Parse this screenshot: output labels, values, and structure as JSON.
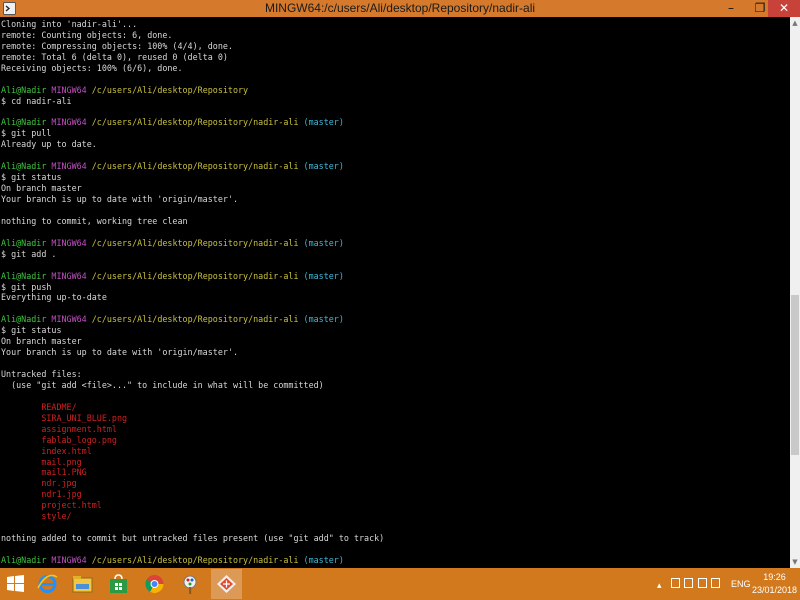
{
  "window": {
    "title": "MINGW64:/c/users/Ali/desktop/Repository/nadir-ali",
    "minimize_glyph": "–",
    "maximize_glyph": "❐",
    "close_glyph": "✕"
  },
  "terminal": {
    "lines": [
      [
        {
          "t": "Cloning into 'nadir-ali'..."
        }
      ],
      [
        {
          "t": "remote: Counting objects: 6, done."
        }
      ],
      [
        {
          "t": "remote: Compressing objects: 100% (4/4), done."
        }
      ],
      [
        {
          "t": "remote: Total 6 (delta 0), reused 0 (delta 0)"
        }
      ],
      [
        {
          "t": "Receiving objects: 100% (6/6), done."
        }
      ],
      [
        {
          "t": ""
        }
      ],
      [
        {
          "t": "Ali@Nadir ",
          "c": "user"
        },
        {
          "t": "MINGW64 ",
          "c": "env"
        },
        {
          "t": "/c/users/Ali/desktop/Repository",
          "c": "path"
        }
      ],
      [
        {
          "t": "$ cd nadir-ali"
        }
      ],
      [
        {
          "t": ""
        }
      ],
      [
        {
          "t": "Ali@Nadir ",
          "c": "user"
        },
        {
          "t": "MINGW64 ",
          "c": "env"
        },
        {
          "t": "/c/users/Ali/desktop/Repository/nadir-ali",
          "c": "path"
        },
        {
          "t": " (master)",
          "c": "branch"
        }
      ],
      [
        {
          "t": "$ git pull"
        }
      ],
      [
        {
          "t": "Already up to date."
        }
      ],
      [
        {
          "t": ""
        }
      ],
      [
        {
          "t": "Ali@Nadir ",
          "c": "user"
        },
        {
          "t": "MINGW64 ",
          "c": "env"
        },
        {
          "t": "/c/users/Ali/desktop/Repository/nadir-ali",
          "c": "path"
        },
        {
          "t": " (master)",
          "c": "branch"
        }
      ],
      [
        {
          "t": "$ git status"
        }
      ],
      [
        {
          "t": "On branch master"
        }
      ],
      [
        {
          "t": "Your branch is up to date with 'origin/master'."
        }
      ],
      [
        {
          "t": ""
        }
      ],
      [
        {
          "t": "nothing to commit, working tree clean"
        }
      ],
      [
        {
          "t": ""
        }
      ],
      [
        {
          "t": "Ali@Nadir ",
          "c": "user"
        },
        {
          "t": "MINGW64 ",
          "c": "env"
        },
        {
          "t": "/c/users/Ali/desktop/Repository/nadir-ali",
          "c": "path"
        },
        {
          "t": " (master)",
          "c": "branch"
        }
      ],
      [
        {
          "t": "$ git add ."
        }
      ],
      [
        {
          "t": ""
        }
      ],
      [
        {
          "t": "Ali@Nadir ",
          "c": "user"
        },
        {
          "t": "MINGW64 ",
          "c": "env"
        },
        {
          "t": "/c/users/Ali/desktop/Repository/nadir-ali",
          "c": "path"
        },
        {
          "t": " (master)",
          "c": "branch"
        }
      ],
      [
        {
          "t": "$ git push"
        }
      ],
      [
        {
          "t": "Everything up-to-date"
        }
      ],
      [
        {
          "t": ""
        }
      ],
      [
        {
          "t": "Ali@Nadir ",
          "c": "user"
        },
        {
          "t": "MINGW64 ",
          "c": "env"
        },
        {
          "t": "/c/users/Ali/desktop/Repository/nadir-ali",
          "c": "path"
        },
        {
          "t": " (master)",
          "c": "branch"
        }
      ],
      [
        {
          "t": "$ git status"
        }
      ],
      [
        {
          "t": "On branch master"
        }
      ],
      [
        {
          "t": "Your branch is up to date with 'origin/master'."
        }
      ],
      [
        {
          "t": ""
        }
      ],
      [
        {
          "t": "Untracked files:"
        }
      ],
      [
        {
          "t": "  (use \"git add <file>...\" to include in what will be committed)"
        }
      ],
      [
        {
          "t": ""
        }
      ],
      [
        {
          "t": "        README/",
          "c": "red"
        }
      ],
      [
        {
          "t": "        SIRA_UNI_BLUE.png",
          "c": "red"
        }
      ],
      [
        {
          "t": "        assignment.html",
          "c": "red"
        }
      ],
      [
        {
          "t": "        fablab_logo.png",
          "c": "red"
        }
      ],
      [
        {
          "t": "        index.html",
          "c": "red"
        }
      ],
      [
        {
          "t": "        mail.png",
          "c": "red"
        }
      ],
      [
        {
          "t": "        mail1.PNG",
          "c": "red"
        }
      ],
      [
        {
          "t": "        ndr.jpg",
          "c": "red"
        }
      ],
      [
        {
          "t": "        ndr1.jpg",
          "c": "red"
        }
      ],
      [
        {
          "t": "        project.html",
          "c": "red"
        }
      ],
      [
        {
          "t": "        style/",
          "c": "red"
        }
      ],
      [
        {
          "t": ""
        }
      ],
      [
        {
          "t": "nothing added to commit but untracked files present (use \"git add\" to track)"
        }
      ],
      [
        {
          "t": ""
        }
      ],
      [
        {
          "t": "Ali@Nadir ",
          "c": "user"
        },
        {
          "t": "MINGW64 ",
          "c": "env"
        },
        {
          "t": "/c/users/Ali/desktop/Repository/nadir-ali",
          "c": "path"
        },
        {
          "t": " (master)",
          "c": "branch"
        }
      ]
    ]
  },
  "colors": {
    "titlebar": "#d57a2c",
    "taskbar": "#d2791e",
    "terminal_bg": "#000000",
    "prompt_user": "#3fc53f",
    "prompt_env": "#c050c0",
    "prompt_path": "#c8c040",
    "prompt_branch": "#40b8d8",
    "untracked": "#d02020"
  },
  "taskbar": {
    "items": [
      {
        "icon": "windows-start-icon"
      },
      {
        "icon": "internet-explorer-icon"
      },
      {
        "icon": "file-explorer-icon"
      },
      {
        "icon": "store-icon"
      },
      {
        "icon": "chrome-icon"
      },
      {
        "icon": "paint-icon"
      },
      {
        "icon": "git-bash-icon",
        "active": true
      }
    ],
    "language": "ENG",
    "time": "19:26",
    "date": "23/01/2018"
  }
}
